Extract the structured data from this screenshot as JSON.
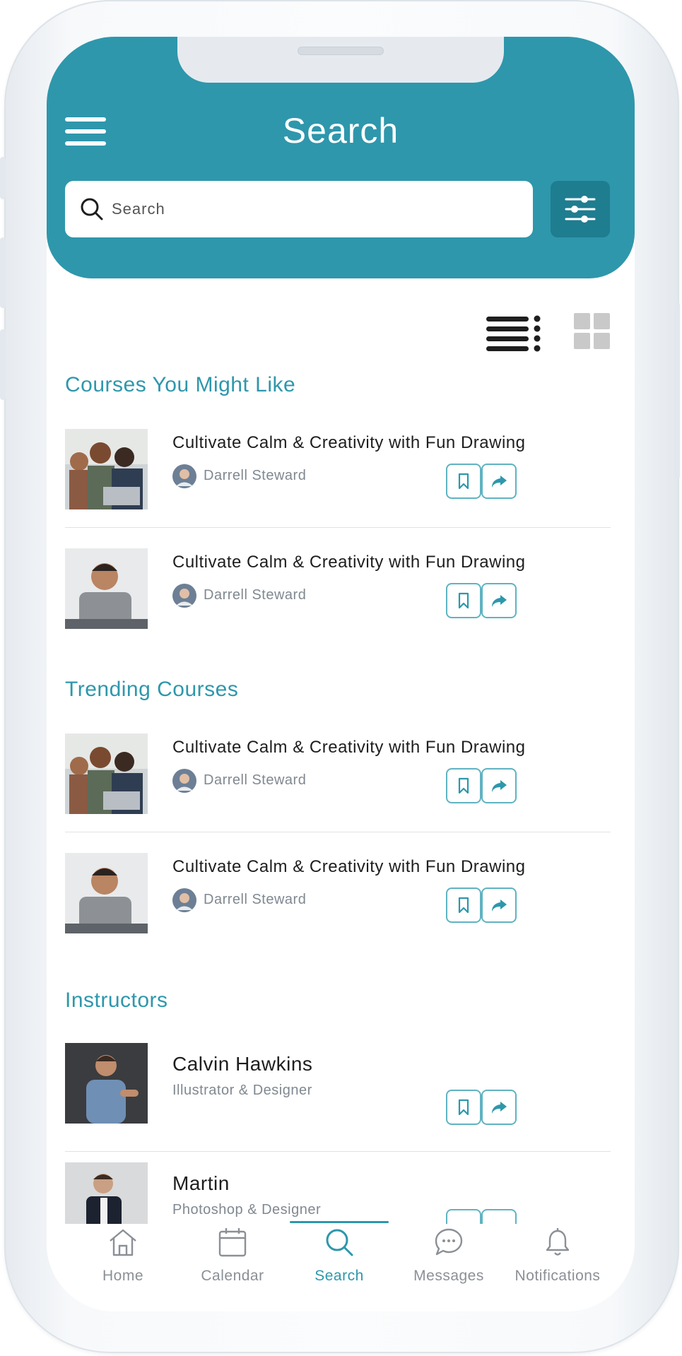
{
  "header": {
    "title": "Search"
  },
  "search": {
    "placeholder": "Search"
  },
  "sections": {
    "recommended": {
      "title": "Courses You Might Like",
      "items": [
        {
          "title": "Cultivate Calm & Creativity with Fun Drawing",
          "author": "Darrell Steward"
        },
        {
          "title": "Cultivate Calm & Creativity with Fun Drawing",
          "author": "Darrell Steward"
        }
      ]
    },
    "trending": {
      "title": "Trending Courses",
      "items": [
        {
          "title": "Cultivate Calm & Creativity with Fun Drawing",
          "author": "Darrell Steward"
        },
        {
          "title": "Cultivate Calm & Creativity with Fun Drawing",
          "author": "Darrell Steward"
        }
      ]
    },
    "instructors": {
      "title": "Instructors",
      "items": [
        {
          "name": "Calvin Hawkins",
          "role": "Illustrator & Designer"
        },
        {
          "name": "Martin",
          "role": "Photoshop & Designer"
        }
      ]
    }
  },
  "nav": {
    "items": [
      {
        "label": "Home",
        "icon": "home-icon"
      },
      {
        "label": "Calendar",
        "icon": "calendar-icon"
      },
      {
        "label": "Search",
        "icon": "search-icon",
        "active": true
      },
      {
        "label": "Messages",
        "icon": "messages-icon"
      },
      {
        "label": "Notifications",
        "icon": "bell-icon"
      }
    ]
  },
  "colors": {
    "accent": "#2e97ac",
    "accent_dark": "#1f7d90",
    "text": "#1e1e1e",
    "muted": "#808890"
  }
}
